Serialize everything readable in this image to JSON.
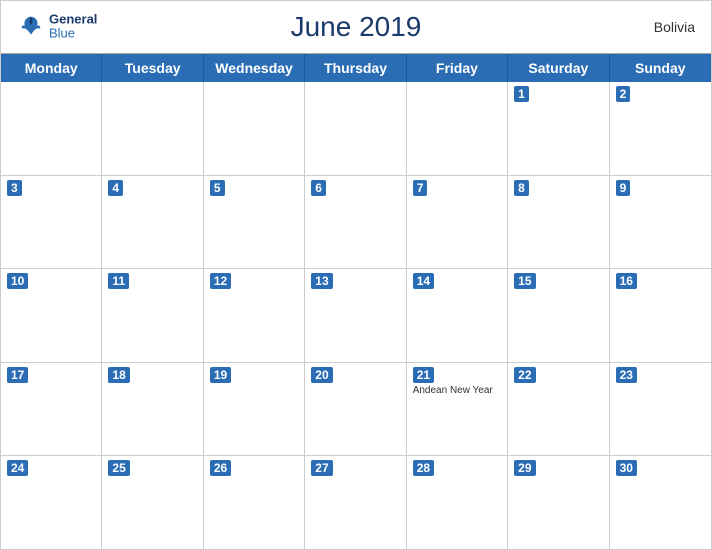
{
  "header": {
    "title": "June 2019",
    "country": "Bolivia",
    "logo": {
      "line1": "General",
      "line2": "Blue"
    }
  },
  "dayHeaders": [
    "Monday",
    "Tuesday",
    "Wednesday",
    "Thursday",
    "Friday",
    "Saturday",
    "Sunday"
  ],
  "weeks": [
    [
      {
        "num": "",
        "event": ""
      },
      {
        "num": "",
        "event": ""
      },
      {
        "num": "",
        "event": ""
      },
      {
        "num": "",
        "event": ""
      },
      {
        "num": "",
        "event": ""
      },
      {
        "num": "1",
        "event": ""
      },
      {
        "num": "2",
        "event": ""
      }
    ],
    [
      {
        "num": "3",
        "event": ""
      },
      {
        "num": "4",
        "event": ""
      },
      {
        "num": "5",
        "event": ""
      },
      {
        "num": "6",
        "event": ""
      },
      {
        "num": "7",
        "event": ""
      },
      {
        "num": "8",
        "event": ""
      },
      {
        "num": "9",
        "event": ""
      }
    ],
    [
      {
        "num": "10",
        "event": ""
      },
      {
        "num": "11",
        "event": ""
      },
      {
        "num": "12",
        "event": ""
      },
      {
        "num": "13",
        "event": ""
      },
      {
        "num": "14",
        "event": ""
      },
      {
        "num": "15",
        "event": ""
      },
      {
        "num": "16",
        "event": ""
      }
    ],
    [
      {
        "num": "17",
        "event": ""
      },
      {
        "num": "18",
        "event": ""
      },
      {
        "num": "19",
        "event": ""
      },
      {
        "num": "20",
        "event": ""
      },
      {
        "num": "21",
        "event": "Andean New Year"
      },
      {
        "num": "22",
        "event": ""
      },
      {
        "num": "23",
        "event": ""
      }
    ],
    [
      {
        "num": "24",
        "event": ""
      },
      {
        "num": "25",
        "event": ""
      },
      {
        "num": "26",
        "event": ""
      },
      {
        "num": "27",
        "event": ""
      },
      {
        "num": "28",
        "event": ""
      },
      {
        "num": "29",
        "event": ""
      },
      {
        "num": "30",
        "event": ""
      }
    ]
  ]
}
